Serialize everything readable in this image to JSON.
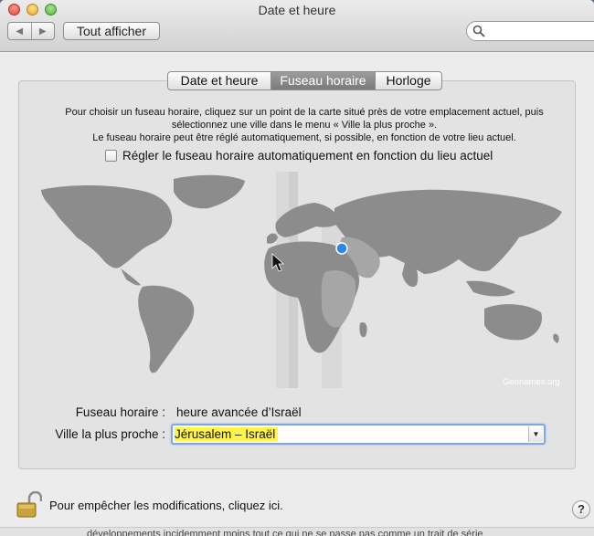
{
  "window": {
    "title": "Date et heure",
    "toolbar": {
      "back_icon": "back-arrow-icon",
      "forward_icon": "forward-arrow-icon",
      "show_all_label": "Tout afficher",
      "search_placeholder": ""
    }
  },
  "tabs": [
    {
      "label": "Date et heure",
      "selected": false
    },
    {
      "label": "Fuseau horaire",
      "selected": true
    },
    {
      "label": "Horloge",
      "selected": false
    }
  ],
  "instructions": [
    "Pour choisir un fuseau horaire, cliquez sur un point de la carte situé près de votre emplacement actuel, puis",
    "sélectionnez une ville dans le menu « Ville la plus proche ».",
    "Le fuseau horaire peut être réglé automatiquement, si possible, en fonction de votre lieu actuel."
  ],
  "auto_timezone": {
    "label": "Régler le fuseau horaire automatiquement en fonction du lieu actuel",
    "checked": false
  },
  "map": {
    "credit": "Geonames.org",
    "selected_location": "Jérusalem",
    "colors": {
      "land": "#8c8c8c",
      "selected_zone": "#a6a6a6",
      "ocean": "#e3e3e3",
      "band": "#d4d4d4",
      "pin": "#2a86f2"
    }
  },
  "timezone": {
    "label": "Fuseau horaire :",
    "value": "heure avancée d’Israël"
  },
  "closest_city": {
    "label": "Ville la plus proche :",
    "value": "Jérusalem – Israël"
  },
  "footer": {
    "lock_text": "Pour empêcher les modifications, cliquez ici.",
    "help_label": "?"
  },
  "background_text": "développements incidemment moins tout ce qui ne se passe pas comme un trait de série"
}
